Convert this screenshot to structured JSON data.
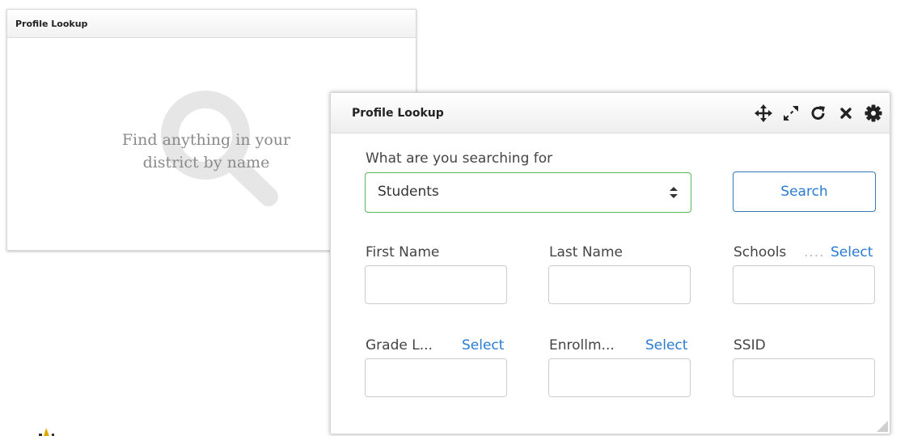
{
  "back_widget": {
    "title": "Profile Lookup",
    "message_line1": "Find anything in your",
    "message_line2": "district by name",
    "icon": "search-icon"
  },
  "front_widget": {
    "title": "Profile Lookup",
    "toolbar": {
      "icons": [
        "move-icon",
        "expand-icon",
        "refresh-icon",
        "close-icon",
        "gear-icon"
      ]
    },
    "search_for": {
      "label": "What are you searching for",
      "selected": "Students"
    },
    "search_button_label": "Search",
    "fields": {
      "first_name": {
        "label": "First Name",
        "value": ""
      },
      "last_name": {
        "label": "Last Name",
        "value": ""
      },
      "schools": {
        "label": "Schools",
        "dots": "....",
        "link": "Select",
        "value": ""
      },
      "grade_level": {
        "label": "Grade L...",
        "link": "Select",
        "value": ""
      },
      "enrollment": {
        "label": "Enrollm...",
        "link": "Select",
        "value": ""
      },
      "ssid": {
        "label": "SSID",
        "value": ""
      }
    }
  },
  "colors": {
    "link_blue": "#2a7bd3",
    "select_border_green": "#5cb85c",
    "button_border_blue": "#337ab7",
    "muted_text": "#8a8a8a"
  }
}
